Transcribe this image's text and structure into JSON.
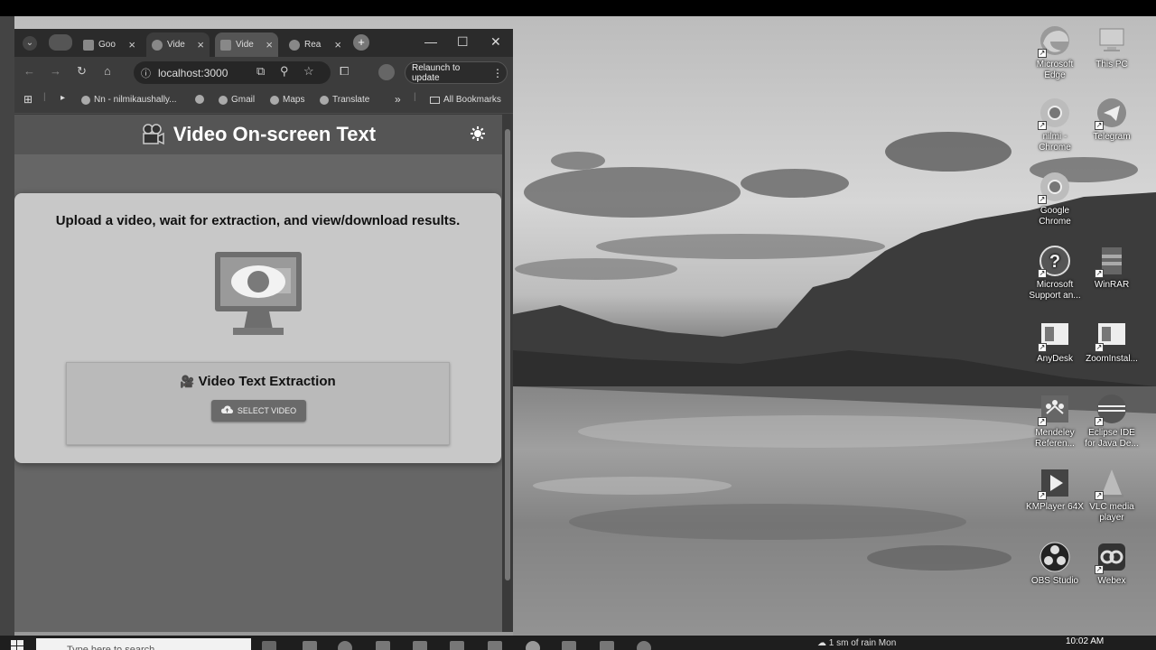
{
  "browser": {
    "tabs": [
      {
        "label": "Goo",
        "icon": "tab-favicon-icon"
      },
      {
        "label": "Vide",
        "icon": "globe-icon",
        "active": true
      },
      {
        "label": "Vide",
        "icon": "tab-favicon-icon"
      },
      {
        "label": "Rea",
        "icon": "react-icon"
      }
    ],
    "url": "localhost:3000",
    "relaunch_label": "Relaunch to update",
    "bookmarks": [
      {
        "label": "Nn - nilmikaushally..."
      },
      {
        "label": "Gmail"
      },
      {
        "label": "Maps"
      },
      {
        "label": "Translate"
      }
    ],
    "all_bookmarks_label": "All Bookmarks"
  },
  "app": {
    "title": "Video On-screen Text",
    "instructions": "Upload a video, wait for extraction, and view/download results.",
    "panel_title": "Video Text Extraction",
    "select_button": "SELECT VIDEO"
  },
  "desktop_icons": [
    {
      "label": "Microsoft Edge",
      "icon": "edge-icon"
    },
    {
      "label": "This PC",
      "icon": "computer-icon"
    },
    {
      "label": "nilmi - Chrome",
      "icon": "chrome-icon"
    },
    {
      "label": "Telegram",
      "icon": "telegram-icon"
    },
    {
      "label": "Google Chrome",
      "icon": "chrome-icon"
    },
    {
      "label": "Microsoft Support an...",
      "icon": "help-icon"
    },
    {
      "label": "WinRAR",
      "icon": "winrar-icon"
    },
    {
      "label": "AnyDesk",
      "icon": "anydesk-icon"
    },
    {
      "label": "ZoomInstal...",
      "icon": "zoom-icon"
    },
    {
      "label": "Mendeley Referen...",
      "icon": "mendeley-icon"
    },
    {
      "label": "Eclipse IDE for Java De...",
      "icon": "eclipse-icon"
    },
    {
      "label": "KMPlayer 64X",
      "icon": "kmplayer-icon"
    },
    {
      "label": "VLC media player",
      "icon": "vlc-icon"
    },
    {
      "label": "OBS Studio",
      "icon": "obs-icon"
    },
    {
      "label": "Webex",
      "icon": "webex-icon"
    }
  ],
  "taskbar": {
    "search_placeholder": "Type here to search",
    "weather": "1 sm of rain Mon",
    "time": "10:02 AM"
  }
}
